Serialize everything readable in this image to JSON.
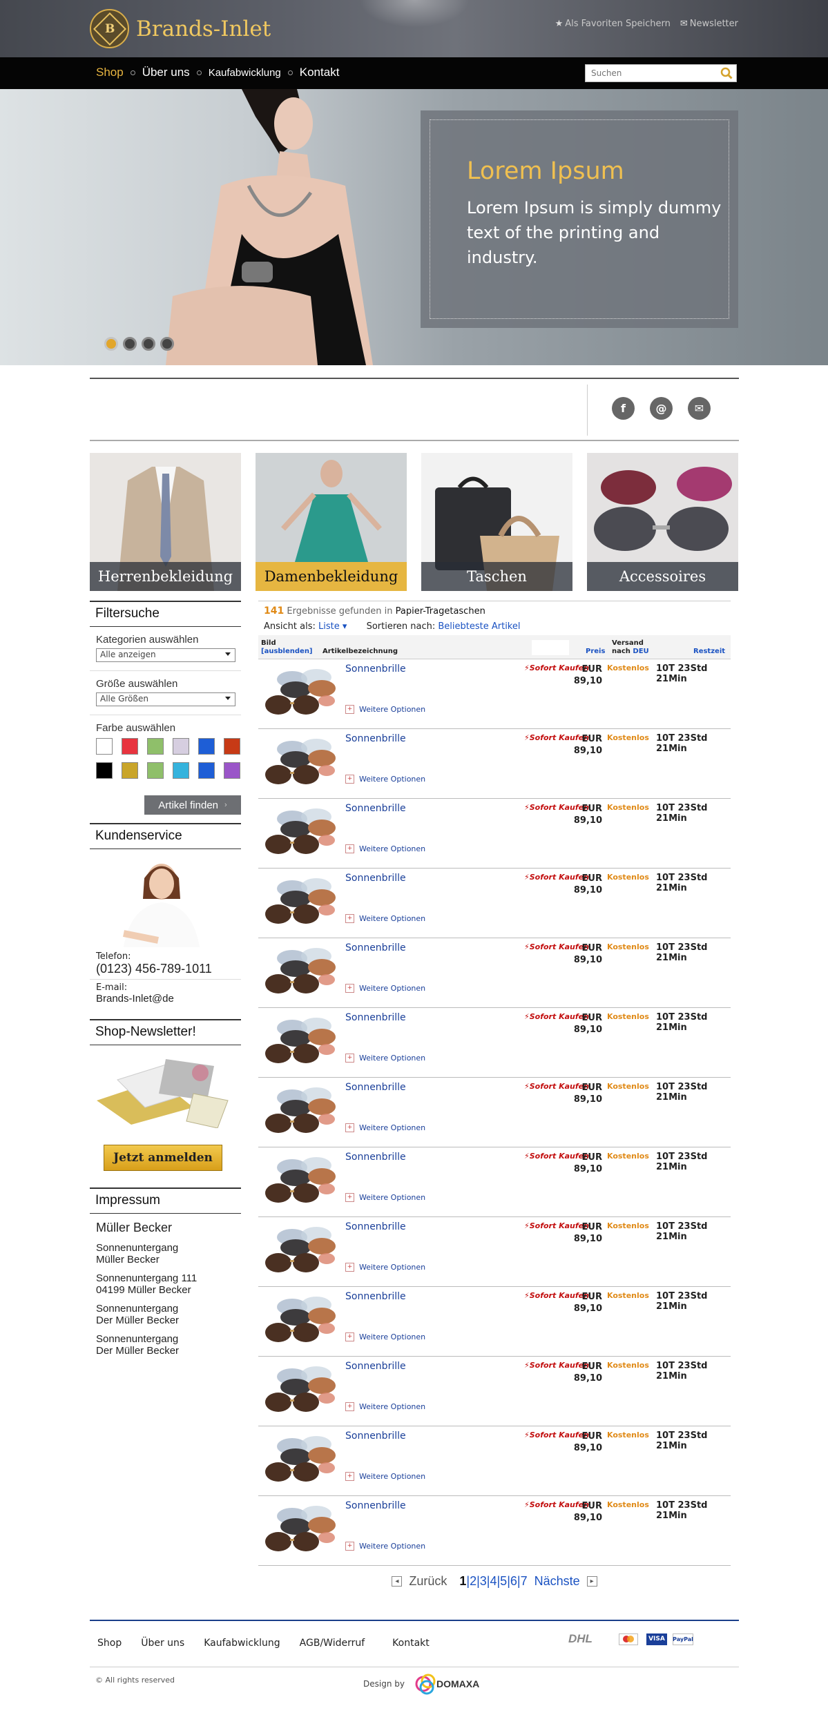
{
  "header": {
    "logo_letter": "B",
    "logo_text": "Brands-Inlet",
    "fav_label": "Als Favoriten Speichern",
    "newsletter_label": "Newsletter"
  },
  "nav": {
    "items": [
      "Shop",
      "Über uns",
      "Kaufabwicklung",
      "Kontakt"
    ],
    "search_placeholder": "Suchen"
  },
  "hero": {
    "title": "Lorem Ipsum",
    "text": "Lorem Ipsum is simply dummy text of the printing and industry.",
    "slides": 4,
    "active_slide": 1
  },
  "categories": [
    "Herrenbekleidung",
    "Damenbekleidung",
    "Taschen",
    "Accessoires"
  ],
  "sidebar": {
    "filter": {
      "title": "Filtersuche",
      "category_label": "Kategorien auswählen",
      "category_value": "Alle anzeigen",
      "size_label": "Größe auswählen",
      "size_value": "Alle Größen",
      "color_label": "Farbe auswählen",
      "colors": [
        "#ffffff",
        "#e8343f",
        "#8fbf6a",
        "#d6cee0",
        "#1e5ed6",
        "#c73a16",
        "#000000",
        "#c9a52a",
        "#8fbf6a",
        "#35b3dd",
        "#1e5ed6",
        "#9a55c8"
      ],
      "find_button": "Artikel finden"
    },
    "service": {
      "title": "Kundenservice",
      "phone_label": "Telefon:",
      "phone": "(0123) 456-789-1011",
      "email_label": "E-mail:",
      "email": "Brands-Inlet@de"
    },
    "newsletter": {
      "title": "Shop-Newsletter!",
      "button": "Jetzt anmelden"
    },
    "impressum": {
      "title": "Impressum",
      "name": "Müller Becker",
      "lines": [
        [
          "Sonnenuntergang",
          "Müller Becker"
        ],
        [
          "Sonnenuntergang 111",
          "04199 Müller Becker"
        ],
        [
          "Sonnenuntergang",
          "Der Müller Becker"
        ],
        [
          "Sonnenuntergang",
          "Der Müller Becker"
        ]
      ]
    }
  },
  "results": {
    "count": "141",
    "found_text": "Ergebnisse gefunden in",
    "query": "Papier-Tragetaschen",
    "view_label": "Ansicht als:",
    "view_value": "Liste",
    "sort_label": "Sortieren nach:",
    "sort_value": "Beliebteste Artikel",
    "col_bild": "Bild",
    "col_hide": "[ausblenden]",
    "col_article": "Artikelbezeichnung",
    "col_price": "Preis",
    "col_ship_1": "Versand",
    "col_ship_2": "nach",
    "col_ship_3": "DEU",
    "col_rest": "Restzeit"
  },
  "products": [
    {
      "name": "Sonnenbrille",
      "badge": "Sofort Kaufen",
      "currency": "EUR",
      "price": "89,10",
      "shipping": "Kostenlos",
      "remaining": "10T 23Std 21Min",
      "options": "Weitere Optionen"
    },
    {
      "name": "Sonnenbrille",
      "badge": "Sofort Kaufen",
      "currency": "EUR",
      "price": "89,10",
      "shipping": "Kostenlos",
      "remaining": "10T 23Std 21Min",
      "options": "Weitere Optionen"
    },
    {
      "name": "Sonnenbrille",
      "badge": "Sofort Kaufen",
      "currency": "EUR",
      "price": "89,10",
      "shipping": "Kostenlos",
      "remaining": "10T 23Std 21Min",
      "options": "Weitere Optionen"
    },
    {
      "name": "Sonnenbrille",
      "badge": "Sofort Kaufen",
      "currency": "EUR",
      "price": "89,10",
      "shipping": "Kostenlos",
      "remaining": "10T 23Std 21Min",
      "options": "Weitere Optionen"
    },
    {
      "name": "Sonnenbrille",
      "badge": "Sofort Kaufen",
      "currency": "EUR",
      "price": "89,10",
      "shipping": "Kostenlos",
      "remaining": "10T 23Std 21Min",
      "options": "Weitere Optionen"
    },
    {
      "name": "Sonnenbrille",
      "badge": "Sofort Kaufen",
      "currency": "EUR",
      "price": "89,10",
      "shipping": "Kostenlos",
      "remaining": "10T 23Std 21Min",
      "options": "Weitere Optionen"
    },
    {
      "name": "Sonnenbrille",
      "badge": "Sofort Kaufen",
      "currency": "EUR",
      "price": "89,10",
      "shipping": "Kostenlos",
      "remaining": "10T 23Std 21Min",
      "options": "Weitere Optionen"
    },
    {
      "name": "Sonnenbrille",
      "badge": "Sofort Kaufen",
      "currency": "EUR",
      "price": "89,10",
      "shipping": "Kostenlos",
      "remaining": "10T 23Std 21Min",
      "options": "Weitere Optionen"
    },
    {
      "name": "Sonnenbrille",
      "badge": "Sofort Kaufen",
      "currency": "EUR",
      "price": "89,10",
      "shipping": "Kostenlos",
      "remaining": "10T 23Std 21Min",
      "options": "Weitere Optionen"
    },
    {
      "name": "Sonnenbrille",
      "badge": "Sofort Kaufen",
      "currency": "EUR",
      "price": "89,10",
      "shipping": "Kostenlos",
      "remaining": "10T 23Std 21Min",
      "options": "Weitere Optionen"
    },
    {
      "name": "Sonnenbrille",
      "badge": "Sofort Kaufen",
      "currency": "EUR",
      "price": "89,10",
      "shipping": "Kostenlos",
      "remaining": "10T 23Std 21Min",
      "options": "Weitere Optionen"
    },
    {
      "name": "Sonnenbrille",
      "badge": "Sofort Kaufen",
      "currency": "EUR",
      "price": "89,10",
      "shipping": "Kostenlos",
      "remaining": "10T 23Std 21Min",
      "options": "Weitere Optionen"
    },
    {
      "name": "Sonnenbrille",
      "badge": "Sofort Kaufen",
      "currency": "EUR",
      "price": "89,10",
      "shipping": "Kostenlos",
      "remaining": "10T 23Std 21Min",
      "options": "Weitere Optionen"
    }
  ],
  "pagination": {
    "prev": "Zurück",
    "current": "1",
    "pages": [
      "2",
      "3",
      "4",
      "5",
      "6",
      "7"
    ],
    "next": "Nächste"
  },
  "footer": {
    "links": [
      "Shop",
      "Über uns",
      "Kaufabwicklung",
      "AGB/Widerruf",
      "Kontakt"
    ],
    "payments": [
      "DHL",
      "MasterCard",
      "VISA",
      "PayPal"
    ],
    "copyright": "© All rights reserved",
    "design_by": "Design by",
    "design_brand": "DOMAXA"
  }
}
